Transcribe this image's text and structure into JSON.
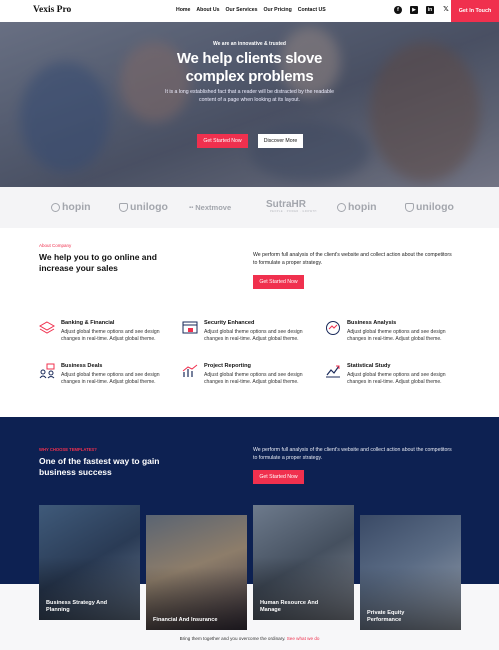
{
  "header": {
    "logo": "Vexis Pro",
    "nav": [
      "Home",
      "About Us",
      "Our Services",
      "Our Pricing",
      "Contact US"
    ],
    "social_icons": [
      "facebook-icon",
      "youtube-icon",
      "linkedin-icon",
      "x-icon"
    ],
    "cta": "Get In Touch",
    "accent": "#f0304e"
  },
  "hero": {
    "subtitle": "We are an innovative & trusted",
    "title_line1": "We help clients slove",
    "title_line2": "complex problems",
    "description": "It is a long established fact that a reader will be distracted by the readable content of a page when looking at its layout.",
    "primary_button": "Get Started Now",
    "secondary_button": "Discover More"
  },
  "partners": {
    "logos": [
      "hopin",
      "unilogo",
      "Nextmove",
      "SutraHR",
      "hopin",
      "unilogo"
    ],
    "sutra_tagline": "PEOPLE · POWER · GROWTH"
  },
  "about": {
    "label": "About Company",
    "title": "We help you to go online and increase your sales",
    "description": "We perform full analysis of the client's website and collect action about the competitors to formulate a proper strategy.",
    "button": "Get Started Now"
  },
  "services": [
    {
      "title": "Banking & Financial",
      "desc": "Adjust global theme options and see design changes in real-time. Adjust global theme.",
      "icon": "layers-icon"
    },
    {
      "title": "Security Enhanced",
      "desc": "Adjust global theme options and see design changes in real-time. Adjust global theme.",
      "icon": "browser-lock-icon"
    },
    {
      "title": "Business Analysis",
      "desc": "Adjust global theme options and see design changes in real-time. Adjust global theme.",
      "icon": "globe-analysis-icon"
    },
    {
      "title": "Business Deals",
      "desc": "Adjust global theme options and see design changes in real-time. Adjust global theme.",
      "icon": "handshake-deal-icon"
    },
    {
      "title": "Project Reporting",
      "desc": "Adjust global theme options and see design changes in real-time. Adjust global theme.",
      "icon": "bar-chart-icon"
    },
    {
      "title": "Statistical Study",
      "desc": "Adjust global theme options and see design changes in real-time. Adjust global theme.",
      "icon": "trend-chart-icon"
    }
  ],
  "why": {
    "label": "WHY CHOOSE TEMPLATES?",
    "title": "One of the fastest way to gain business success",
    "description": "We perform full analysis of the client's website and collect action about the competitors to formulate a proper strategy.",
    "button": "Get Started Now"
  },
  "cards": [
    {
      "title": "Business Strategy And Planning"
    },
    {
      "title": "Financial And Insurance"
    },
    {
      "title": "Human Resource And Manage"
    },
    {
      "title": "Private Equity Performance"
    }
  ],
  "footer": {
    "text": "Bring them together and you overcome the ordinary.",
    "link": "See what we do"
  }
}
